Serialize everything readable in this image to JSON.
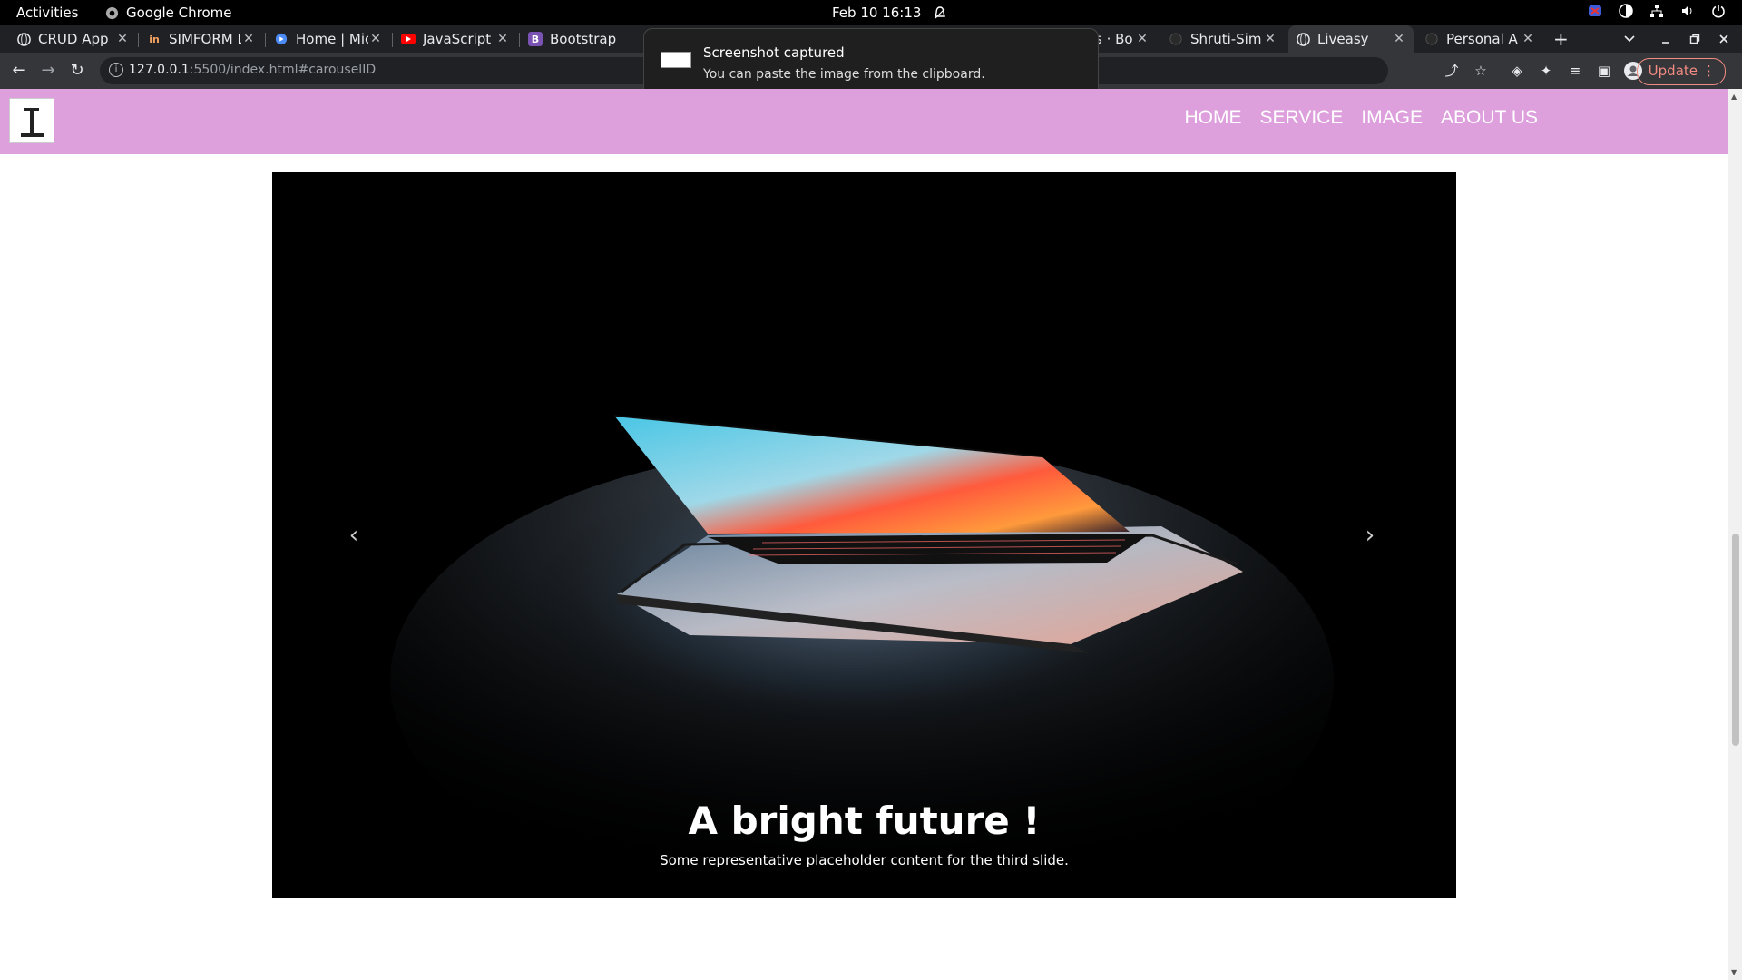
{
  "system": {
    "activities": "Activities",
    "app_name": "Google Chrome",
    "datetime": "Feb 10  16:13"
  },
  "tabs": [
    {
      "title": "CRUD App",
      "icon": "globe-icon"
    },
    {
      "title": "SIMFORM L",
      "icon": "simform-icon"
    },
    {
      "title": "Home | Mic",
      "icon": "home-icon"
    },
    {
      "title": "JavaScript",
      "icon": "youtube-icon"
    },
    {
      "title": "Bootstrap",
      "icon": "bootstrap-icon"
    },
    {
      "title": "s · Bo",
      "icon": "none"
    },
    {
      "title": "Shruti-Sim",
      "icon": "github-icon"
    },
    {
      "title": "Liveasy",
      "icon": "globe-icon",
      "active": true
    },
    {
      "title": "Personal A",
      "icon": "github-icon"
    }
  ],
  "browser": {
    "url_host": "127.0.0.1",
    "url_rest": ":5500/index.html#carouselID",
    "update_label": "Update"
  },
  "notification": {
    "title": "Screenshot captured",
    "body": "You can paste the image from the clipboard."
  },
  "site_nav": {
    "items": [
      "HOME",
      "SERVICE",
      "IMAGE",
      "ABOUT US"
    ]
  },
  "carousel": {
    "caption_title": "A bright future !",
    "caption_text": "Some representative placeholder content for the third slide."
  }
}
